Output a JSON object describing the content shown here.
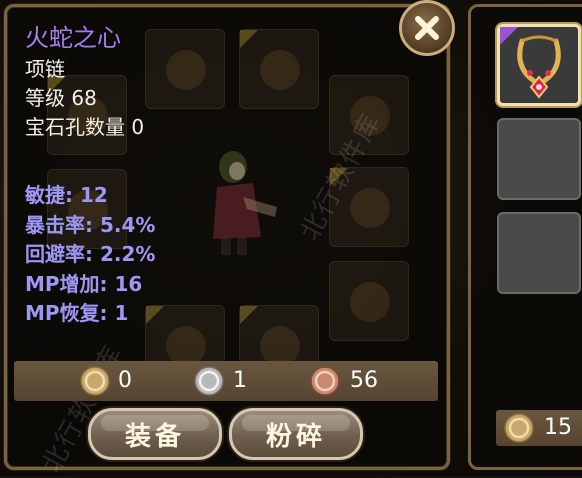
{
  "item": {
    "name": "火蛇之心",
    "type": "项链",
    "level": "等级 68",
    "sockets": "宝石孔数量 0"
  },
  "stats": [
    "敏捷: 12",
    "暴击率: 5.4%",
    "回避率: 2.2%",
    "MP增加: 16",
    "MP恢复: 1"
  ],
  "currency": {
    "gold": "0",
    "silver": "1",
    "copper": "56"
  },
  "buttons": {
    "equip": "装备",
    "smash": "粉碎"
  },
  "side_panel": {
    "gold": "15"
  },
  "watermark": "北行软件库",
  "colors": {
    "item_name": "#a67ef2",
    "stat_text": "#9e97f4",
    "rarity_tag": "#9a52d6"
  }
}
